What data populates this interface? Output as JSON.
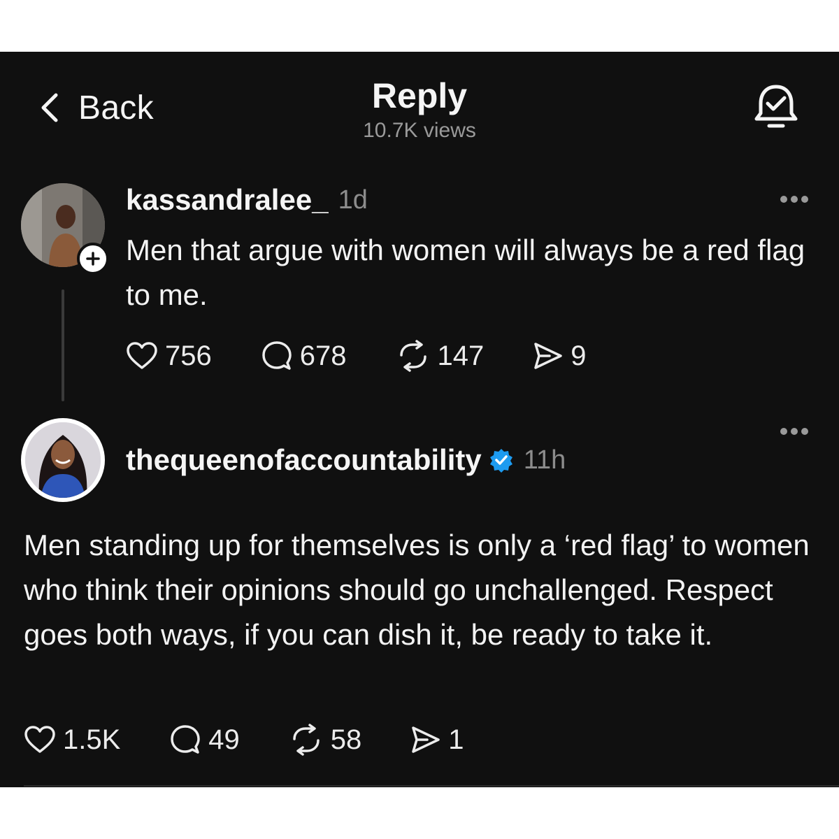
{
  "header": {
    "back_label": "Back",
    "title": "Reply",
    "views": "10.7K views"
  },
  "posts": [
    {
      "username": "kassandralee_",
      "time": "1d",
      "text": "Men that argue with women will always be a red flag to me.",
      "likes": "756",
      "comments": "678",
      "reposts": "147",
      "shares": "9"
    },
    {
      "username": "thequeenofaccountability",
      "time": "11h",
      "text": "Men standing up for themselves is only a ‘red flag’ to women who think their opinions should go unchallenged. Respect goes both ways, if you can dish it, be ready to take it.",
      "likes": "1.5K",
      "comments": "49",
      "reposts": "58",
      "shares": "1"
    }
  ],
  "colors": {
    "background": "#101010",
    "text": "#f3f3f3",
    "muted": "#8c8c8c",
    "verified": "#1d9bf0"
  }
}
